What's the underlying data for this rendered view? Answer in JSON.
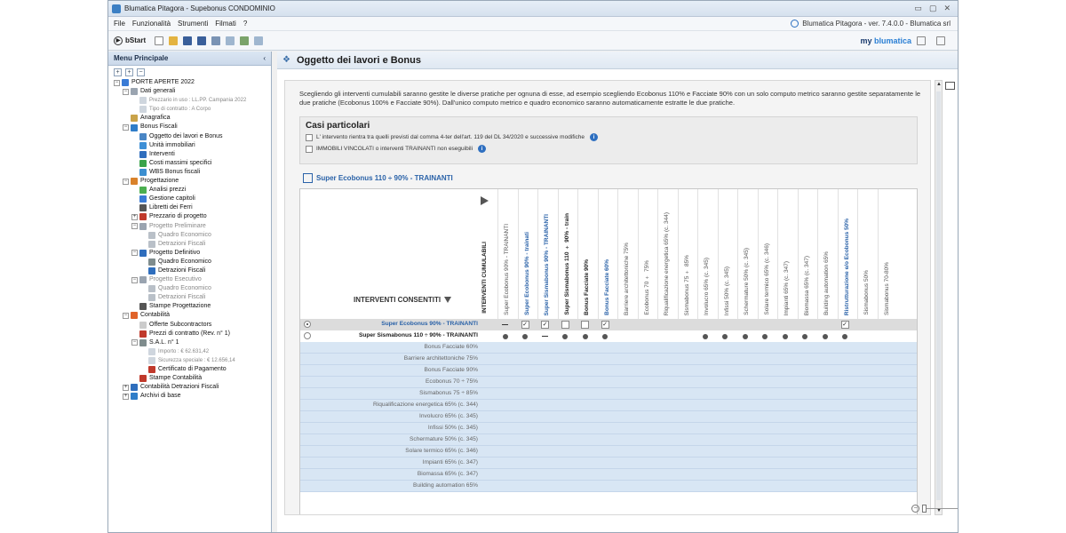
{
  "window": {
    "title": "Blumatica Pitagora - Supebonus CONDOMINIO",
    "controls": [
      "▭",
      "▢",
      "✕"
    ]
  },
  "menu": {
    "items": [
      "File",
      "Funzionalità",
      "Strumenti",
      "Filmati",
      "?"
    ],
    "version": "Blumatica Pitagora - ver. 7.4.0.0 - Blumatica srl"
  },
  "toolbar": {
    "bstart": "bStart",
    "logo_prefix": "my",
    "logo_brand": "blumatica"
  },
  "sidebar": {
    "title": "Menu Principale",
    "collapse": "‹",
    "tree": [
      {
        "label": "PORTE APERTE 2022",
        "level": 0,
        "style": "normal",
        "expander": "−",
        "color": "#3a7bd5"
      },
      {
        "label": "Dati generali",
        "level": 1,
        "style": "normal",
        "expander": "−",
        "color": "#9aa4b0"
      },
      {
        "label": "Prezzario in uso : LL.PP. Campania 2022",
        "level": 2,
        "style": "small",
        "expander": "",
        "color": "#cfd6de"
      },
      {
        "label": "Tipo di contratto : A Corpo",
        "level": 2,
        "style": "small",
        "expander": "",
        "color": "#cfd6de"
      },
      {
        "label": "Anagrafica",
        "level": 1,
        "style": "normal",
        "expander": "",
        "color": "#c9a34a"
      },
      {
        "label": "Bonus Fiscali",
        "level": 1,
        "style": "normal",
        "expander": "−",
        "color": "#2f7dc8"
      },
      {
        "label": "Oggetto dei lavori e Bonus",
        "level": 2,
        "style": "normal",
        "expander": "",
        "color": "#4a86c5"
      },
      {
        "label": "Unità immobiliari",
        "level": 2,
        "style": "normal",
        "expander": "",
        "color": "#3e8fd6"
      },
      {
        "label": "Interventi",
        "level": 2,
        "style": "normal",
        "expander": "",
        "color": "#2f6ebd"
      },
      {
        "label": "Costi massimi specifici",
        "level": 2,
        "style": "normal",
        "expander": "",
        "color": "#3aa34a"
      },
      {
        "label": "WBS Bonus fiscali",
        "level": 2,
        "style": "normal",
        "expander": "",
        "color": "#3c8fd0"
      },
      {
        "label": "Progettazione",
        "level": 1,
        "style": "normal",
        "expander": "−",
        "color": "#d9822b"
      },
      {
        "label": "Analisi prezzi",
        "level": 2,
        "style": "normal",
        "expander": "",
        "color": "#4caf50"
      },
      {
        "label": "Gestione capitoli",
        "level": 2,
        "style": "normal",
        "expander": "",
        "color": "#3a7bd5"
      },
      {
        "label": "Libretti dei Ferri",
        "level": 2,
        "style": "normal",
        "expander": "",
        "color": "#555555"
      },
      {
        "label": "Prezzario di progetto",
        "level": 2,
        "style": "normal",
        "expander": "+",
        "color": "#c0392b"
      },
      {
        "label": "Progetto Preliminare",
        "level": 2,
        "style": "grey",
        "expander": "−",
        "color": "#9aa4b0"
      },
      {
        "label": "Quadro Economico",
        "level": 3,
        "style": "grey",
        "expander": "",
        "color": "#b9c0c8"
      },
      {
        "label": "Detrazioni Fiscali",
        "level": 3,
        "style": "grey",
        "expander": "",
        "color": "#b9c0c8"
      },
      {
        "label": "Progetto Definitivo",
        "level": 2,
        "style": "normal",
        "expander": "−",
        "color": "#2f6ebd"
      },
      {
        "label": "Quadro Economico",
        "level": 3,
        "style": "normal",
        "expander": "",
        "color": "#7f8c8d"
      },
      {
        "label": "Detrazioni Fiscali",
        "level": 3,
        "style": "normal",
        "expander": "",
        "color": "#2f6ebd"
      },
      {
        "label": "Progetto Esecutivo",
        "level": 2,
        "style": "grey",
        "expander": "−",
        "color": "#9aa4b0"
      },
      {
        "label": "Quadro Economico",
        "level": 3,
        "style": "grey",
        "expander": "",
        "color": "#b9c0c8"
      },
      {
        "label": "Detrazioni Fiscali",
        "level": 3,
        "style": "grey",
        "expander": "",
        "color": "#b9c0c8"
      },
      {
        "label": "Stampe Progettazione",
        "level": 2,
        "style": "normal",
        "expander": "",
        "color": "#555555"
      },
      {
        "label": "Contabilità",
        "level": 1,
        "style": "normal",
        "expander": "−",
        "color": "#e0632a"
      },
      {
        "label": "Offerte Subcontractors",
        "level": 2,
        "style": "normal",
        "expander": "",
        "color": "#cccccc"
      },
      {
        "label": "Prezzi di contratto (Rev. n° 1)",
        "level": 2,
        "style": "normal",
        "expander": "",
        "color": "#c0392b"
      },
      {
        "label": "S.A.L. n° 1",
        "level": 2,
        "style": "normal",
        "expander": "−",
        "color": "#7f8c8d"
      },
      {
        "label": "Importo : € 62.631,42",
        "level": 3,
        "style": "small",
        "expander": "",
        "color": "#cfd6de"
      },
      {
        "label": "Sicurezza speciale : € 12.656,14",
        "level": 3,
        "style": "small",
        "expander": "",
        "color": "#cfd6de"
      },
      {
        "label": "Certificato di Pagamento",
        "level": 3,
        "style": "normal",
        "expander": "",
        "color": "#c0392b"
      },
      {
        "label": "Stampe Contabilità",
        "level": 2,
        "style": "normal",
        "expander": "",
        "color": "#c0392b"
      },
      {
        "label": "Contabilità Detrazioni Fiscali",
        "level": 1,
        "style": "normal",
        "expander": "+",
        "color": "#2f6ebd"
      },
      {
        "label": "Archivi di base",
        "level": 1,
        "style": "normal",
        "expander": "+",
        "color": "#2f7dc8"
      }
    ]
  },
  "main": {
    "title": "Oggetto dei lavori e Bonus",
    "description": "Scegliendo gli interventi cumulabili saranno gestite le diverse pratiche per ognuna di esse, ad esempio scegliendo Ecobonus 110% e Facciate 90% con un solo computo metrico saranno gestite separatamente le due pratiche (Ecobonus 100% e Facciate 90%). Dall'unico computo metrico e quadro economico saranno automaticamente estratte le due pratiche.",
    "casi": {
      "title": "Casi particolari",
      "options": [
        "L' intervento rientra tra quelli previsti dal comma 4-ter dell'art. 119 del DL 34/2020 e successive modifiche",
        "IMMOBILI VINCOLATI o interventi TRAINANTI non eseguibili"
      ],
      "info_icon": "i"
    },
    "section_title": "Super Ecobonus 110 ÷ 90% - TRAINANTI",
    "grid": {
      "corner_label": "INTERVENTI CONSENTITI",
      "cumulabili_label": "INTERVENTI CUMULABILI",
      "columns": [
        {
          "label": "Super Ecobonus 90% - TRAINANTI",
          "style": "grey"
        },
        {
          "label": "Super Ecobonus 90% - trainati",
          "style": "blue"
        },
        {
          "label": "Super Sismabonus 90% - TRAINANTI",
          "style": "blue"
        },
        {
          "label": "Super Sismabonus 110 ÷ 90% - train",
          "style": "bold"
        },
        {
          "label": "Bonus Facciate 90%",
          "style": "bold"
        },
        {
          "label": "Bonus Facciate 60%",
          "style": "blue"
        },
        {
          "label": "Barriere architettoniche 75%",
          "style": "grey"
        },
        {
          "label": "Ecobonus 70 ÷ 75%",
          "style": "grey"
        },
        {
          "label": "Riqualificazione energetica 65% (c. 344)",
          "style": "grey"
        },
        {
          "label": "Sismabonus 75 ÷ 85%",
          "style": "grey"
        },
        {
          "label": "Involucro 65% (c. 345)",
          "style": "grey"
        },
        {
          "label": "Infissi 50% (c. 345)",
          "style": "grey"
        },
        {
          "label": "Schermature 50% (c. 345)",
          "style": "grey"
        },
        {
          "label": "Solare termico 65% (c. 346)",
          "style": "grey"
        },
        {
          "label": "Impianti 65% (c. 347)",
          "style": "grey"
        },
        {
          "label": "Biomassa 65% (c. 347)",
          "style": "grey"
        },
        {
          "label": "Building automation 65%",
          "style": "grey"
        },
        {
          "label": "Ristrutturazione e/o Ecobonus 50%",
          "style": "blue"
        },
        {
          "label": "Sismabonus 50%",
          "style": "grey"
        },
        {
          "label": "Sismabonus 70-80%",
          "style": "grey"
        }
      ],
      "rows": [
        {
          "label": "Super Ecobonus 90% - TRAINANTI",
          "type": "sel",
          "radio": "on",
          "cells": [
            "dash",
            "check",
            "check",
            "empty",
            "empty",
            "check",
            "",
            "",
            "",
            "",
            "",
            "",
            "",
            "",
            "",
            "",
            "",
            "check",
            "",
            ""
          ]
        },
        {
          "label": "Super Sismabonus 110 ÷ 90% - TRAINANTI",
          "type": "bold",
          "radio": "off",
          "cells": [
            "dot",
            "dot",
            "dash",
            "dot",
            "dot",
            "dot",
            "",
            "",
            "",
            "",
            "dot",
            "dot",
            "dot",
            "dot",
            "dot",
            "dot",
            "dot",
            "dot",
            "",
            ""
          ]
        },
        {
          "label": "Bonus Facciate 60%",
          "type": "blue",
          "radio": "",
          "cells": []
        },
        {
          "label": "Barriere architettoniche 75%",
          "type": "blue",
          "radio": "",
          "cells": []
        },
        {
          "label": "Bonus Facciate 90%",
          "type": "blue",
          "radio": "",
          "cells": []
        },
        {
          "label": "Ecobonus 70 ÷ 75%",
          "type": "blue",
          "radio": "",
          "cells": []
        },
        {
          "label": "Sismabonus 75 ÷ 85%",
          "type": "blue",
          "radio": "",
          "cells": []
        },
        {
          "label": "Riqualificazione energetica 65% (c. 344)",
          "type": "blue",
          "radio": "",
          "cells": []
        },
        {
          "label": "Involucro 65% (c. 345)",
          "type": "blue",
          "radio": "",
          "cells": []
        },
        {
          "label": "Infissi 50% (c. 345)",
          "type": "blue",
          "radio": "",
          "cells": []
        },
        {
          "label": "Schermature 50% (c. 345)",
          "type": "blue",
          "radio": "",
          "cells": []
        },
        {
          "label": "Solare termico 65% (c. 346)",
          "type": "blue",
          "radio": "",
          "cells": []
        },
        {
          "label": "Impianti 65% (c. 347)",
          "type": "blue",
          "radio": "",
          "cells": []
        },
        {
          "label": "Biomassa 65% (c. 347)",
          "type": "blue",
          "radio": "",
          "cells": []
        },
        {
          "label": "Building automation 65%",
          "type": "blue",
          "radio": "",
          "cells": []
        }
      ]
    },
    "zoom": {
      "minus": "−",
      "plus": "+",
      "level": 0
    }
  }
}
